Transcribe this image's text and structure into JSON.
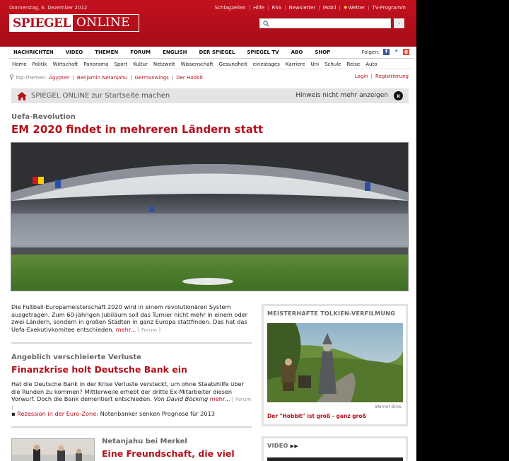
{
  "header": {
    "date": "Donnerstag, 6. Dezember 2012",
    "top_links": [
      "Schlagzeilen",
      "Hilfe",
      "RSS",
      "Newsletter",
      "Mobil",
      "Wetter",
      "TV-Programm"
    ],
    "logo_part1": "SPIEGEL",
    "logo_part2": "ONLINE",
    "search_placeholder": "",
    "search_button": "›"
  },
  "main_nav": [
    "NACHRICHTEN",
    "VIDEO",
    "THEMEN",
    "FORUM",
    "ENGLISH",
    "DER SPIEGEL",
    "SPIEGEL TV",
    "ABO",
    "SHOP"
  ],
  "follow": {
    "label": "Folgen:"
  },
  "sub_nav": [
    "Home",
    "Politik",
    "Wirtschaft",
    "Panorama",
    "Sport",
    "Kultur",
    "Netzwelt",
    "Wissenschaft",
    "Gesundheit",
    "einestages",
    "Karriere",
    "Uni",
    "Schule",
    "Reise",
    "Auto"
  ],
  "top_themen": {
    "label": "Top-Themen:",
    "items": [
      "Ägypten",
      "Benjamin Netanjahu",
      "Germanwings",
      "Der Hobbit"
    ],
    "login": "Login",
    "register": "Registrierung"
  },
  "hint": {
    "text": "SPIEGEL ONLINE zur Startseite machen",
    "dismiss": "Hinweis nicht mehr anzeigen",
    "close": "x"
  },
  "lead": {
    "kicker": "Uefa-Revolution",
    "headline": "EM 2020 findet in mehreren Ländern statt",
    "teaser": "Die Fußball-Europameisterschaft 2020 wird in einem revolutionären System ausgetragen. Zum 60-jährigen Jubiläum soll das Turnier nicht mehr in einem oder zwei Ländern, sondern in großen Städten in ganz Europa stattfinden. Das hat das Uefa-Exekutivkomitee entschieden.",
    "more": "mehr...",
    "forum": "[ Forum ]"
  },
  "article2": {
    "kicker": "Angeblich verschleierte Verluste",
    "headline": "Finanzkrise holt Deutsche Bank ein",
    "teaser": "Hat die Deutsche Bank in der Krise Verluste versteckt, um ohne Staatshilfe über die Runden zu kommen? Mittlerweile erhebt der dritte Ex-Mitarbeiter diesen Vorwurf. Doch die Bank dementiert entschieden.",
    "author": "Von David Böcking",
    "more": "mehr...",
    "forum": "[ Forum ]",
    "related_link": "Rezession in der Euro-Zone:",
    "related_text": "Notenbanker senken Prognose für 2013"
  },
  "article3": {
    "kicker": "Netanjahu bei Merkel",
    "headline": "Eine Freundschaft, die viel"
  },
  "box_tolkien": {
    "title": "MEISTERHAFTE TOLKIEN-VERFILMUNG",
    "credit": "Warner Bros.",
    "caption": "Der \"Hobbit\" ist groß - ganz groß"
  },
  "box_video": {
    "title": "VIDEO"
  },
  "colors": {
    "brand_red": "#b3101c",
    "grey_box": "#e4e4e4"
  }
}
